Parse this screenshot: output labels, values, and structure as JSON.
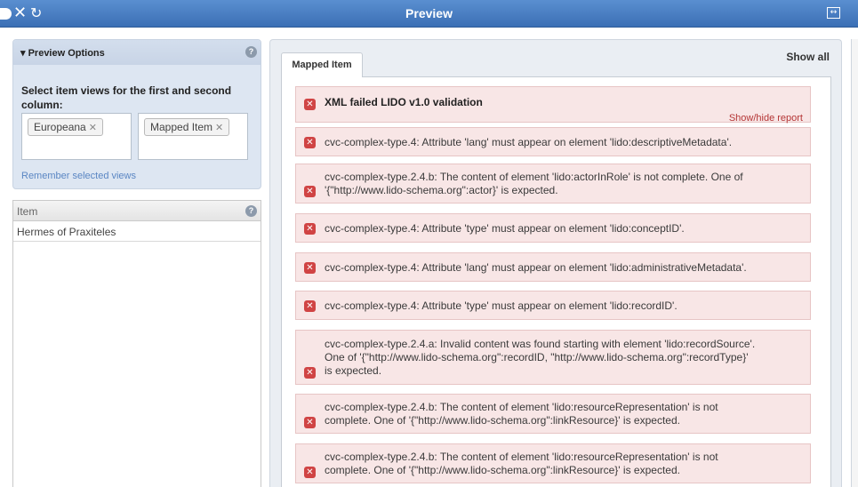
{
  "titlebar": {
    "title": "Preview",
    "icons": [
      "tab-icon",
      "close-icon",
      "undo-icon",
      "expand-icon"
    ]
  },
  "preview_options": {
    "header": "▾ Preview Options",
    "select_label": "Select item views for the first and second column:",
    "first_column_chip": "Europeana",
    "second_column_chip": "Mapped Item",
    "remember_link": "Remember selected views"
  },
  "item_panel": {
    "header": "Item",
    "rows": [
      "Hermes of Praxiteles"
    ]
  },
  "right_panel": {
    "tab_label": "Mapped Item",
    "show_all": "Show all"
  },
  "report": {
    "title": "XML failed LIDO v1.0 validation",
    "show_hide": "Show/hide report",
    "errors": [
      {
        "lines": [
          "cvc-complex-type.4: Attribute 'lang' must appear on element 'lido:descriptiveMetadata'."
        ]
      },
      {
        "lines": [
          "cvc-complex-type.2.4.b: The content of element 'lido:actorInRole' is not complete. One of",
          "'{\"http://www.lido-schema.org\":actor}' is expected."
        ]
      },
      {
        "lines": [
          "cvc-complex-type.4: Attribute 'type' must appear on element 'lido:conceptID'."
        ]
      },
      {
        "lines": [
          "cvc-complex-type.4: Attribute 'lang' must appear on element 'lido:administrativeMetadata'."
        ]
      },
      {
        "lines": [
          "cvc-complex-type.4: Attribute 'type' must appear on element 'lido:recordID'."
        ]
      },
      {
        "lines": [
          "cvc-complex-type.2.4.a: Invalid content was found starting with element 'lido:recordSource'.",
          "One of '{\"http://www.lido-schema.org\":recordID, \"http://www.lido-schema.org\":recordType}'",
          "is expected."
        ]
      },
      {
        "lines": [
          "cvc-complex-type.2.4.b: The content of element 'lido:resourceRepresentation' is not",
          "complete. One of '{\"http://www.lido-schema.org\":linkResource}' is expected."
        ]
      },
      {
        "lines": [
          "cvc-complex-type.2.4.b: The content of element 'lido:resourceRepresentation' is not",
          "complete. One of '{\"http://www.lido-schema.org\":linkResource}' is expected."
        ]
      }
    ]
  }
}
